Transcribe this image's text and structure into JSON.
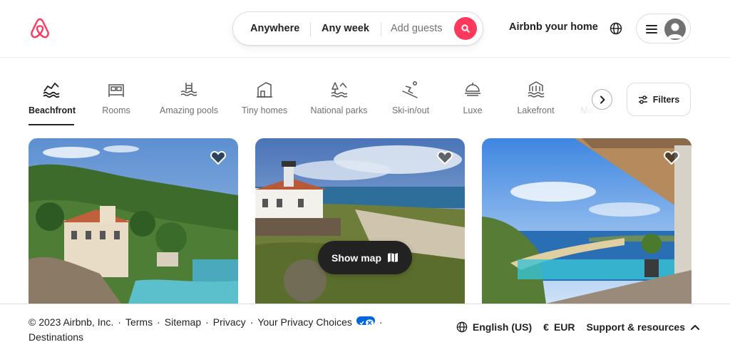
{
  "header": {
    "search": {
      "location": "Anywhere",
      "dates": "Any week",
      "guests_placeholder": "Add guests"
    },
    "host_link": "Airbnb your home"
  },
  "categories": [
    {
      "label": "Beachfront",
      "icon": "beachfront-icon",
      "active": true
    },
    {
      "label": "Rooms",
      "icon": "rooms-icon",
      "active": false
    },
    {
      "label": "Amazing pools",
      "icon": "pool-icon",
      "active": false
    },
    {
      "label": "Tiny homes",
      "icon": "tiny-home-icon",
      "active": false
    },
    {
      "label": "National parks",
      "icon": "national-park-icon",
      "active": false
    },
    {
      "label": "Ski-in/out",
      "icon": "ski-icon",
      "active": false
    },
    {
      "label": "Luxe",
      "icon": "luxe-icon",
      "active": false
    },
    {
      "label": "Lakefront",
      "icon": "lakefront-icon",
      "active": false
    },
    {
      "label": "Ma",
      "icon": "category-icon",
      "active": false
    }
  ],
  "filters_label": "Filters",
  "show_map_label": "Show map",
  "footer": {
    "copyright": "© 2023 Airbnb, Inc.",
    "terms": "Terms",
    "sitemap": "Sitemap",
    "privacy": "Privacy",
    "privacy_choices": "Your Privacy Choices",
    "destinations": "Destinations",
    "language": "English (US)",
    "currency_symbol": "€",
    "currency": "EUR",
    "support": "Support & resources"
  },
  "colors": {
    "brand": "#ff385c",
    "text": "#222222",
    "muted": "#717171",
    "privacy_toggle": "#0066e0"
  }
}
